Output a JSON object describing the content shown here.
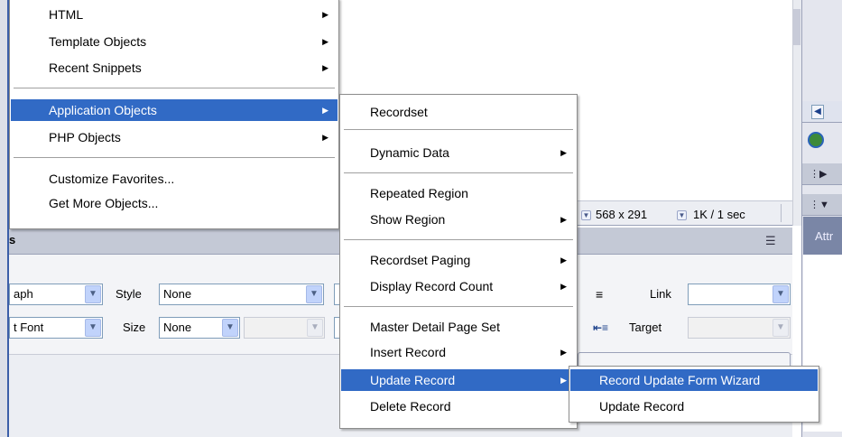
{
  "status_bar": {
    "dims": "568 x 291",
    "size_time": "1K / 1 sec"
  },
  "properties_panel": {
    "title_fragment": "s",
    "format_value": "aph",
    "font_value": "t Font",
    "style_label": "Style",
    "style_value": "None",
    "size_label": "Size",
    "size_value": "None",
    "link_label": "Link",
    "target_label": "Target"
  },
  "right_panel": {
    "attr_label": "Attr"
  },
  "main_menu": {
    "items": [
      {
        "label": "HTML",
        "submenu": true
      },
      {
        "label": "Template Objects",
        "submenu": true
      },
      {
        "label": "Recent Snippets",
        "submenu": true
      },
      {
        "label": "Application Objects",
        "submenu": true,
        "highlighted": true
      },
      {
        "label": "PHP Objects",
        "submenu": true
      },
      {
        "label": "Customize Favorites...",
        "submenu": false
      },
      {
        "label": "Get More Objects...",
        "submenu": false
      }
    ]
  },
  "application_objects_menu": {
    "items": [
      {
        "label": "Recordset",
        "submenu": false
      },
      {
        "label": "Dynamic Data",
        "submenu": true
      },
      {
        "label": "Repeated Region",
        "submenu": false
      },
      {
        "label": "Show Region",
        "submenu": true
      },
      {
        "label": "Recordset Paging",
        "submenu": true
      },
      {
        "label": "Display Record Count",
        "submenu": true
      },
      {
        "label": "Master Detail Page Set",
        "submenu": false
      },
      {
        "label": "Insert Record",
        "submenu": true
      },
      {
        "label": "Update Record",
        "submenu": true,
        "highlighted": true
      },
      {
        "label": "Delete Record",
        "submenu": false
      }
    ]
  },
  "update_record_menu": {
    "items": [
      {
        "label": "Record Update Form Wizard",
        "highlighted": true
      },
      {
        "label": "Update Record",
        "highlighted": false
      }
    ]
  },
  "colors": {
    "menu_highlight": "#316ac5",
    "panel_header": "#c4c9d6",
    "frame_blue": "#3b5ea8"
  }
}
